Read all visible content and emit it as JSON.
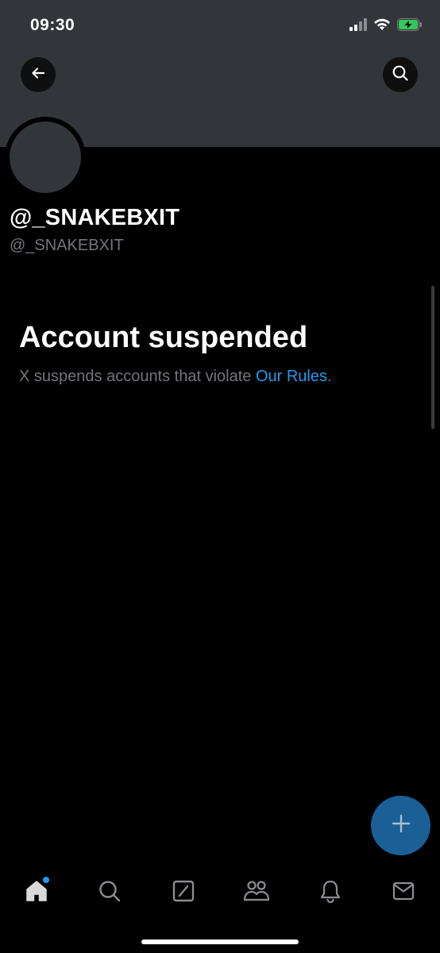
{
  "status_bar": {
    "time": "09:30",
    "icons": [
      "cellular-signal-icon",
      "wifi-icon",
      "battery-charging-icon"
    ]
  },
  "header": {
    "back_icon": "arrow-left-icon",
    "search_icon": "search-icon",
    "banner_color": "#32363a"
  },
  "profile": {
    "display_name": "@_SNAKEBXIT",
    "handle": "@_SNAKEBXIT"
  },
  "suspension": {
    "title": "Account suspended",
    "message_prefix": "X suspends accounts that violate ",
    "rules_link": "Our Rules",
    "message_suffix": "."
  },
  "fab": {
    "icon": "plus-icon",
    "color": "#1a5f96"
  },
  "tab_bar": {
    "items": [
      {
        "name": "home",
        "icon": "home-icon",
        "has_badge": true
      },
      {
        "name": "search",
        "icon": "search-icon"
      },
      {
        "name": "grok",
        "icon": "grok-icon"
      },
      {
        "name": "communities",
        "icon": "people-icon"
      },
      {
        "name": "notifications",
        "icon": "bell-icon"
      },
      {
        "name": "messages",
        "icon": "mail-icon"
      }
    ]
  },
  "colors": {
    "background": "#000000",
    "accent": "#1d9bf0",
    "secondary_text": "#71767b"
  }
}
